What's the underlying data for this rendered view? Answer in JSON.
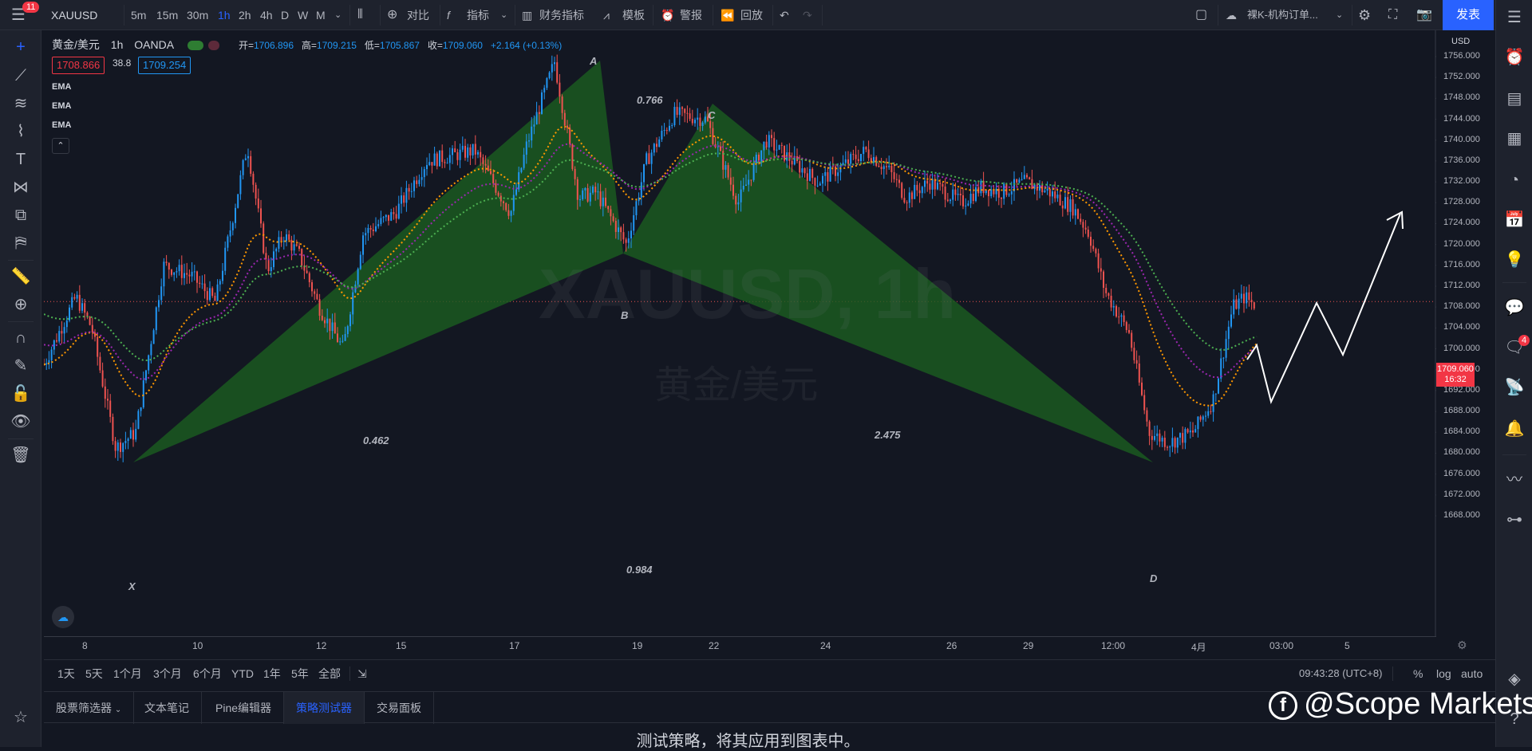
{
  "topbar": {
    "badge": "11",
    "symbol": "XAUUSD",
    "intervals": [
      "5m",
      "15m",
      "30m",
      "1h",
      "2h",
      "4h",
      "D",
      "W",
      "M"
    ],
    "active_interval": "1h",
    "compare": "对比",
    "indicators": "指标",
    "financials": "财务指标",
    "templates": "模板",
    "alert": "警报",
    "replay": "回放",
    "layout_name": "裸K-机构订单...",
    "publish": "发表"
  },
  "legend": {
    "title": "黄金/美元",
    "interval": "1h",
    "source": "OANDA",
    "open_label": "开=",
    "open": "1706.896",
    "high_label": "高=",
    "high": "1709.215",
    "low_label": "低=",
    "low": "1705.867",
    "close_label": "收=",
    "close": "1709.060",
    "change": "+2.164 (+0.13%)",
    "bid": "1708.866",
    "spread": "38.8",
    "ask": "1709.254",
    "ema": [
      "EMA",
      "EMA",
      "EMA"
    ]
  },
  "watermark_symbol": "XAUUSD, 1h",
  "watermark_name": "黄金/美元",
  "price_axis": {
    "currency": "USD",
    "ticks": [
      "1756.000",
      "1752.000",
      "1748.000",
      "1744.000",
      "1740.000",
      "1736.000",
      "1732.000",
      "1728.000",
      "1724.000",
      "1720.000",
      "1716.000",
      "1712.000",
      "1708.000",
      "1704.000",
      "1700.000",
      "1696.000",
      "1692.000",
      "1688.000",
      "1684.000",
      "1680.000",
      "1676.000",
      "1672.000",
      "1668.000"
    ],
    "current_price": "1709.060",
    "countdown": "16:32"
  },
  "time_axis": [
    "8",
    "10",
    "12",
    "15",
    "17",
    "19",
    "22",
    "24",
    "26",
    "29",
    "12:00",
    "4月",
    "03:00",
    "5"
  ],
  "pattern": {
    "points": [
      "X",
      "A",
      "B",
      "C",
      "D"
    ],
    "ratios": [
      "0.766",
      "0.462",
      "2.475",
      "0.984"
    ]
  },
  "timeframes": [
    "1天",
    "5天",
    "1个月",
    "3个月",
    "6个月",
    "YTD",
    "1年",
    "5年",
    "全部"
  ],
  "clock": "09:43:28 (UTC+8)",
  "scale_opts": [
    "%",
    "log",
    "auto"
  ],
  "bottom_tabs": [
    "股票筛选器",
    "文本笔记",
    "Pine编辑器",
    "策略测试器",
    "交易面板"
  ],
  "active_tab": "策略测试器",
  "bottom_message": "测试策略，将其应用到图表中。",
  "brand": "@Scope Markets",
  "notif_badge": "4",
  "colors": {
    "bull": "#2196f3",
    "bear": "#ef5350",
    "pattern": "#1b5e20",
    "ema1": "#ff9800",
    "ema2": "#9c27b0",
    "ema3": "#4caf50",
    "accent": "#2962ff"
  }
}
